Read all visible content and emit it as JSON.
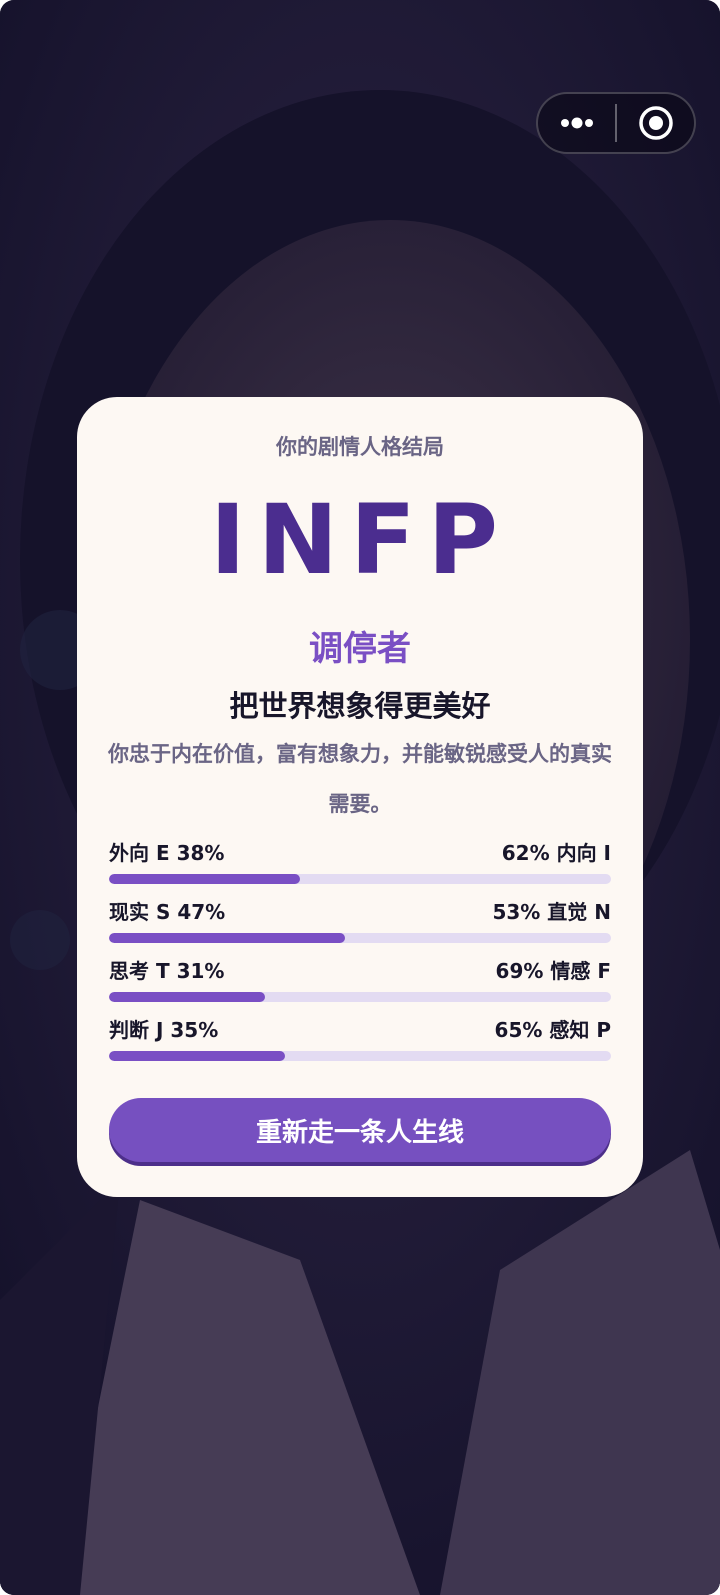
{
  "capsule": {
    "more_icon": "more-dots-icon",
    "close_icon": "target-close-icon"
  },
  "result": {
    "subtitle": "你的剧情人格结局",
    "type_code": "INFP",
    "type_name": "调停者",
    "tagline": "把世界想象得更美好",
    "description": "你忠于内在价值，富有想象力，并能敏锐感受人的真实需要。"
  },
  "dimensions": [
    {
      "left": "外向 E  38%",
      "right": "62%  内向 I",
      "left_percent": 38
    },
    {
      "left": "现实 S  47%",
      "right": "53%  直觉 N",
      "left_percent": 47
    },
    {
      "left": "思考 T  31%",
      "right": "69%  情感 F",
      "left_percent": 31
    },
    {
      "left": "判断 J  35%",
      "right": "65%  感知 P",
      "left_percent": 35
    }
  ],
  "actions": {
    "restart_label": "重新走一条人生线"
  },
  "colors": {
    "primary": "#7a4fc4",
    "type_code": "#4b2d8f",
    "card_bg": "#fdf8f3",
    "track": "#e3dbf2"
  }
}
